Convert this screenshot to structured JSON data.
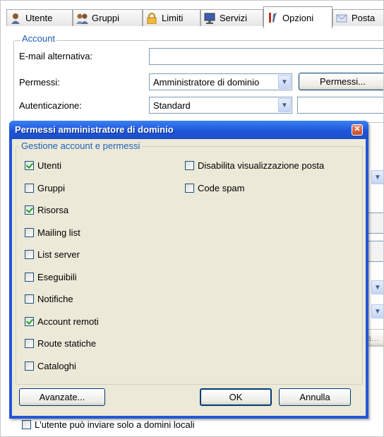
{
  "tabs": [
    {
      "label": "Utente",
      "icon": "user-icon"
    },
    {
      "label": "Gruppi",
      "icon": "group-icon"
    },
    {
      "label": "Limiti",
      "icon": "lock-icon"
    },
    {
      "label": "Servizi",
      "icon": "monitor-icon"
    },
    {
      "label": "Opzioni",
      "icon": "tools-icon",
      "active": true
    },
    {
      "label": "Posta",
      "icon": "mail-icon"
    }
  ],
  "account": {
    "legend": "Account",
    "email_label": "E-mail alternativa:",
    "email_value": "",
    "permessi_label": "Permessi:",
    "permessi_value": "Amministratore di dominio",
    "permessi_button": "Permessi...",
    "auth_label": "Autenticazione:",
    "auth_value": "Standard"
  },
  "background": {
    "partial_button": "ta...",
    "bottom_checkbox": "L'utente può inviare solo a domini locali"
  },
  "dialog": {
    "title": "Permessi amministratore di dominio",
    "group_legend": "Gestione account e permessi",
    "left_items": [
      {
        "label": "Utenti",
        "checked": true
      },
      {
        "label": "Gruppi",
        "checked": false
      },
      {
        "label": "Risorsa",
        "checked": true
      },
      {
        "label": "Mailing list",
        "checked": false
      },
      {
        "label": "List server",
        "checked": false
      },
      {
        "label": "Eseguibili",
        "checked": false
      },
      {
        "label": "Notifiche",
        "checked": false
      },
      {
        "label": "Account remoti",
        "checked": true
      },
      {
        "label": "Route statiche",
        "checked": false
      },
      {
        "label": "Cataloghi",
        "checked": false
      }
    ],
    "right_items": [
      {
        "label": "Disabilita visualizzazione posta",
        "checked": false
      },
      {
        "label": "Code spam",
        "checked": false
      }
    ],
    "advanced_button": "Avanzate...",
    "ok_button": "OK",
    "cancel_button": "Annulla"
  },
  "colors": {
    "title_bar": "#2457d6",
    "dialog_body": "#ece9d8",
    "legend_text": "#1e5fb4",
    "check_mark": "#21a121"
  }
}
